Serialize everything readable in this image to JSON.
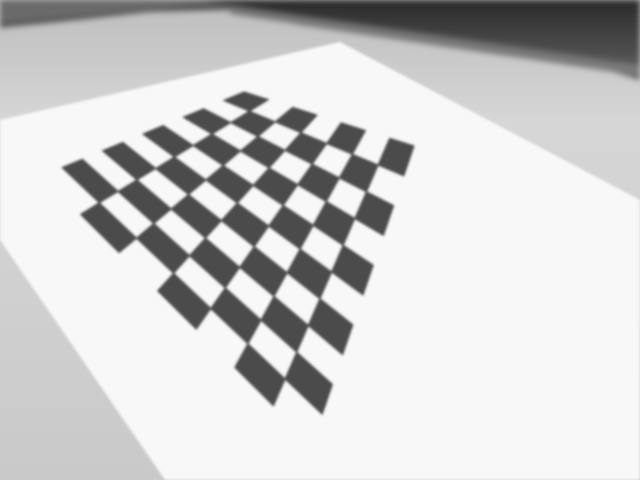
{
  "image": {
    "subject": "checkerboard-on-paper",
    "grid": {
      "rows": 10,
      "cols": 7
    },
    "colors": {
      "table": "#cfcfcf",
      "paper": "#f8f8f8",
      "dark_square": "#4b4b4b",
      "keyboard": "#3a3a3a"
    }
  }
}
